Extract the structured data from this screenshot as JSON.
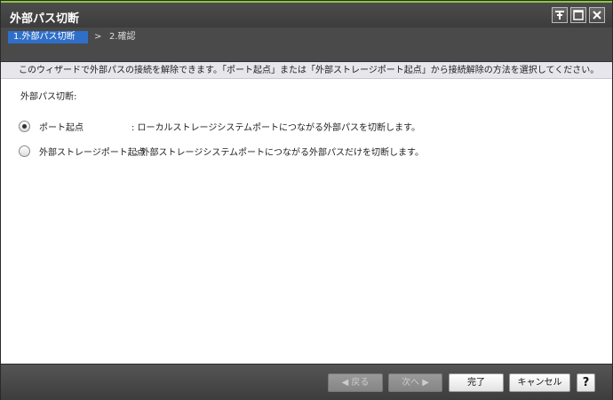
{
  "window": {
    "title": "外部パス切断"
  },
  "title_buttons": [
    "pin-icon",
    "maximize-icon",
    "close-icon"
  ],
  "steps": {
    "current": "1.外部パス切断",
    "separator": ">",
    "next": "2.確認"
  },
  "description": "このウィザードで外部パスの接続を解除できます。「ポート起点」または「外部ストレージポート起点」から接続解除の方法を選択してください。",
  "form": {
    "label": "外部パス切断:",
    "options": [
      {
        "name": "ポート起点",
        "desc": ": ローカルストレージシステムポートにつながる外部パスを切断します。",
        "checked": true
      },
      {
        "name": "外部ストレージポート起点",
        "desc": ": 外部ストレージシステムポートにつながる外部パスだけを切断します。",
        "checked": false
      }
    ]
  },
  "footer": {
    "back": "◀ 戻る",
    "next": "次へ ▶",
    "finish": "完了",
    "cancel": "キャンセル",
    "help": "?"
  }
}
